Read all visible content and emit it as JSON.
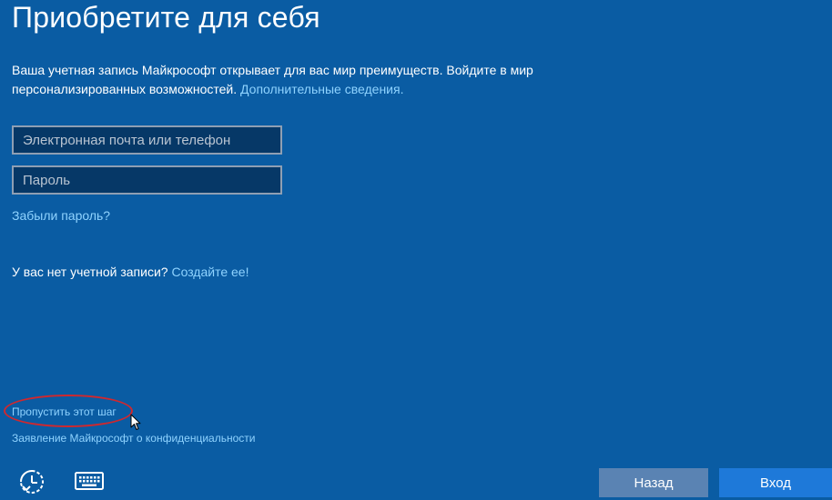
{
  "page": {
    "title": "Приобретите для себя"
  },
  "intro": {
    "text": "Ваша учетная запись Майкрософт открывает для вас мир преимуществ. Войдите в мир персонализированных возможностей.",
    "more_link": "Дополнительные сведения."
  },
  "form": {
    "email_placeholder": "Электронная почта или телефон",
    "email_value": "",
    "password_placeholder": "Пароль",
    "password_value": "",
    "forgot_link": "Забыли пароль?"
  },
  "no_account": {
    "text": "У вас нет учетной записи?",
    "create_link": "Создайте ее!"
  },
  "footer": {
    "skip_link": "Пропустить этот шаг",
    "privacy_link": "Заявление Майкрософт о конфиденциальности"
  },
  "buttons": {
    "back": "Назад",
    "sign_in": "Вход"
  },
  "icons": {
    "ease_of_access": "ease-of-access-icon",
    "keyboard": "keyboard-icon"
  },
  "colors": {
    "background": "#0a5ca3",
    "link": "#8fd3ff",
    "annotation_ring": "#d0282e",
    "back_button": "#5a83b3",
    "signin_button": "#1e79d9"
  }
}
